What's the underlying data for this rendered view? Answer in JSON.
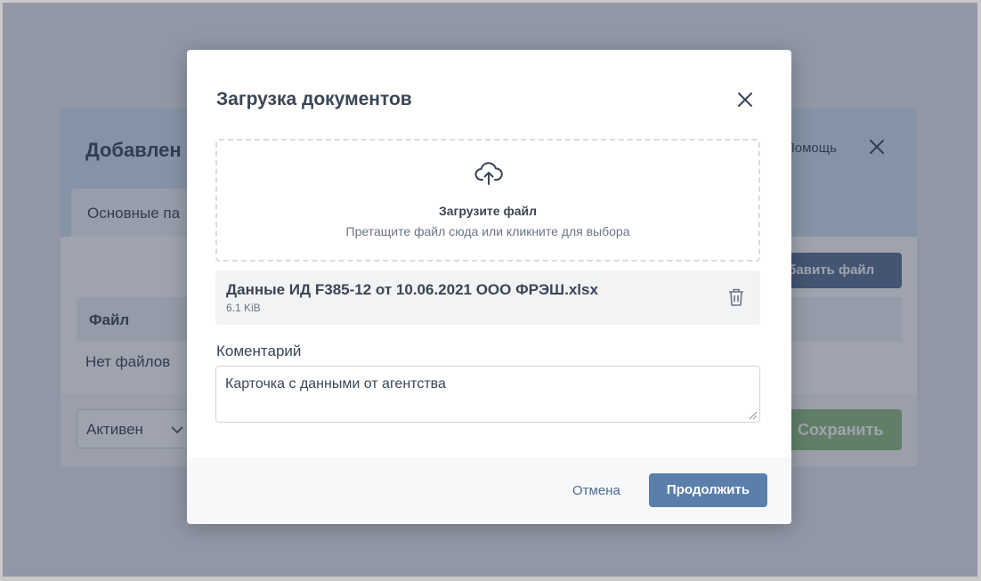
{
  "background_dialog": {
    "title": "Добавлен",
    "help_label": "Помощь",
    "tab_label": "Основные па",
    "add_file_button": "обавить файл",
    "table_header_file": "Файл",
    "empty_text": "Нет файлов",
    "status_select": "Активен",
    "save_button": "Сохранить"
  },
  "modal": {
    "title": "Загрузка документов",
    "dropzone": {
      "title": "Загрузите файл",
      "hint": "Претащите файл сюда или кликните для выбора",
      "icon": "cloud-upload-icon"
    },
    "file": {
      "name": "Данные ИД F385-12 от 10.06.2021 ООО ФРЭШ.xlsx",
      "size": "6.1 KiB"
    },
    "comment": {
      "label": "Коментарий",
      "value": "Карточка с данными от агентства"
    },
    "cancel_button": "Отмена",
    "continue_button": "Продолжить"
  },
  "colors": {
    "primary": "#5b7fab",
    "success": "#8ebd7d",
    "header_tint": "#cfe3f1",
    "text": "#3a4656"
  }
}
